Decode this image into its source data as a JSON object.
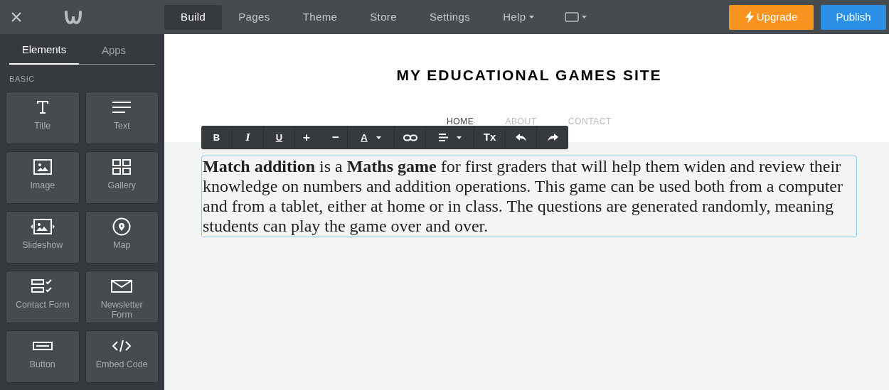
{
  "top_tabs": [
    {
      "label": "Build",
      "selected": true,
      "kind": "plain"
    },
    {
      "label": "Pages",
      "selected": false,
      "kind": "plain"
    },
    {
      "label": "Theme",
      "selected": false,
      "kind": "plain"
    },
    {
      "label": "Store",
      "selected": false,
      "kind": "plain"
    },
    {
      "label": "Settings",
      "selected": false,
      "kind": "plain"
    },
    {
      "label": "Help",
      "selected": false,
      "kind": "menu"
    }
  ],
  "upgrade_button": "Upgrade",
  "publish_button": "Publish",
  "sidebar": {
    "tabs": [
      {
        "label": "Elements",
        "selected": true
      },
      {
        "label": "Apps",
        "selected": false
      }
    ],
    "section": "BASIC",
    "elements": [
      {
        "label": "Title",
        "kind": "title"
      },
      {
        "label": "Text",
        "kind": "text"
      },
      {
        "label": "Image",
        "kind": "image"
      },
      {
        "label": "Gallery",
        "kind": "gallery"
      },
      {
        "label": "Slideshow",
        "kind": "slideshow"
      },
      {
        "label": "Map",
        "kind": "map"
      },
      {
        "label": "Contact Form",
        "kind": "form"
      },
      {
        "label": "Newsletter Form",
        "kind": "newsletter"
      },
      {
        "label": "Button",
        "kind": "button"
      },
      {
        "label": "Embed Code",
        "kind": "code"
      }
    ]
  },
  "site": {
    "title": "MY EDUCATIONAL GAMES SITE",
    "nav": [
      {
        "label": "HOME",
        "selected": true
      },
      {
        "label": "ABOUT",
        "selected": false
      },
      {
        "label": "CONTACT",
        "selected": false
      }
    ],
    "toolbar": [
      {
        "kind": "bold",
        "label": "B"
      },
      {
        "kind": "italic",
        "label": "I"
      },
      {
        "kind": "underline",
        "label": "U"
      },
      {
        "kind": "sizes",
        "labels": [
          "+",
          "−"
        ]
      },
      {
        "kind": "color",
        "label": "A"
      },
      {
        "kind": "link"
      },
      {
        "kind": "align"
      },
      {
        "kind": "clear",
        "label": "Tx"
      },
      {
        "kind": "undo"
      },
      {
        "kind": "redo"
      }
    ],
    "paragraph": "**Match addition** is a **Maths game** for first graders that will help them widen and review their knowledge on numbers and addition operations. This game can be used both from a computer and from a tablet, either at home or in class. The questions are generated randomly, meaning students can play the game over and over."
  }
}
